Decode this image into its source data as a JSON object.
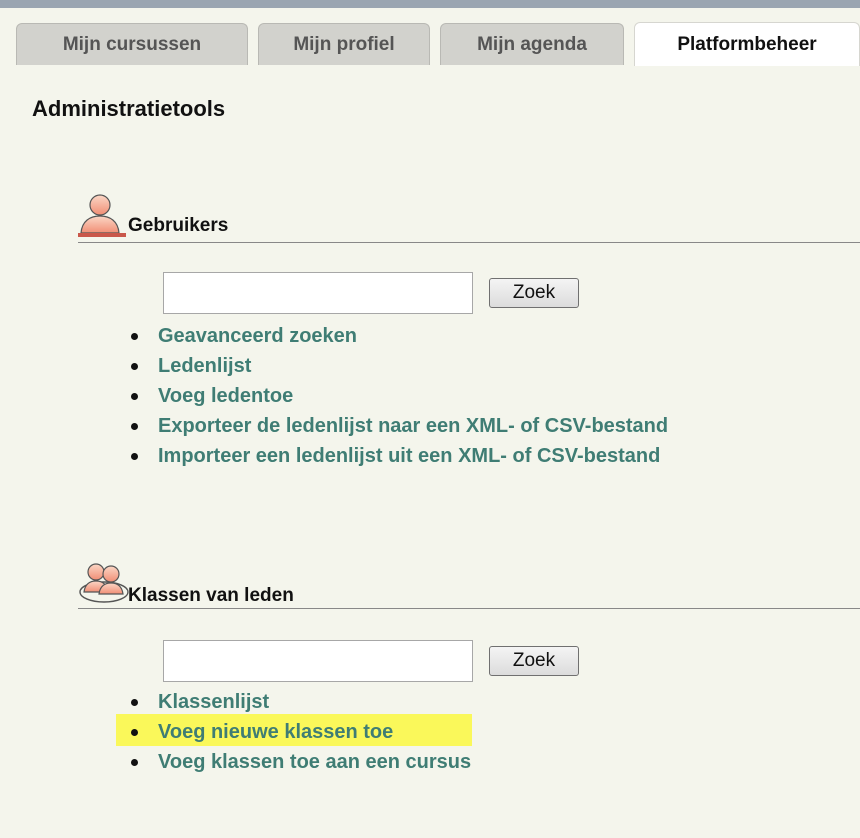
{
  "tabs": [
    {
      "label": "Mijn cursussen",
      "active": false
    },
    {
      "label": "Mijn profiel",
      "active": false
    },
    {
      "label": "Mijn agenda",
      "active": false
    },
    {
      "label": "Platformbeheer",
      "active": true
    }
  ],
  "page": {
    "title": "Administratietools"
  },
  "users_section": {
    "title": "Gebruikers",
    "icon": "user-icon",
    "search": {
      "value": "",
      "placeholder": "",
      "button_label": "Zoek"
    },
    "links": [
      "Geavanceerd zoeken",
      "Ledenlijst",
      "Voeg ledentoe",
      "Exporteer de ledenlijst naar een XML- of CSV-bestand",
      "Importeer een ledenlijst uit een XML- of CSV-bestand"
    ]
  },
  "classes_section": {
    "title": "Klassen van leden",
    "icon": "user-group-icon",
    "search": {
      "value": "",
      "placeholder": "",
      "button_label": "Zoek"
    },
    "links": [
      "Klassenlijst",
      "Voeg nieuwe klassen toe",
      "Voeg klassen toe aan een cursus"
    ],
    "highlighted_link": "Voeg nieuwe klassen toe"
  },
  "colors": {
    "background": "#f4f5ec",
    "link": "#3f7d74",
    "highlight": "#faf85a",
    "tab_inactive": "#d2d2cd",
    "tab_active": "#ffffff"
  }
}
